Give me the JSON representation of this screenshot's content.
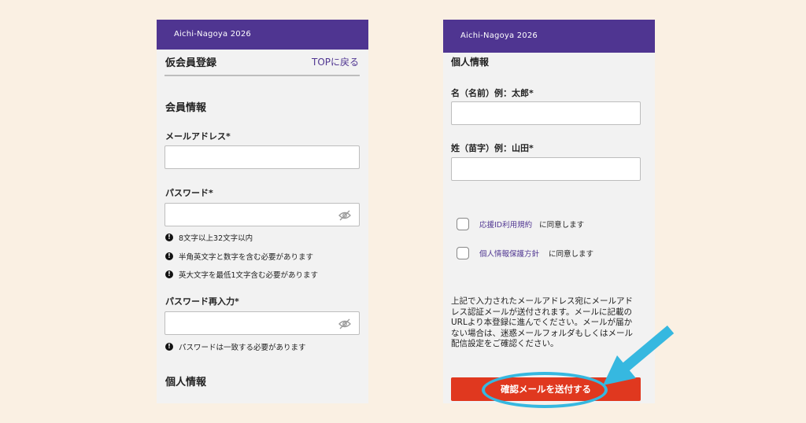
{
  "left": {
    "header": "Aichi-Nagoya 2026",
    "page_title": "仮会員登録",
    "top_link": "TOPに戻る",
    "section_member": "会員情報",
    "email_label": "メールアドレス*",
    "password_label": "パスワード*",
    "password_rules": [
      "8文字以上32文字以内",
      "半角英文字と数字を含む必要があります",
      "英大文字を最低1文字含む必要があります"
    ],
    "password_confirm_label": "パスワード再入力*",
    "password_confirm_rule": "パスワードは一致する必要があります",
    "section_personal": "個人情報"
  },
  "right": {
    "header": "Aichi-Nagoya 2026",
    "section_personal": "個人情報",
    "first_name_label": "名（名前）例：太郎*",
    "last_name_label": "姓（苗字）例：山田*",
    "agreements": [
      {
        "link": "応援ID利用規約",
        "text": "に同意します"
      },
      {
        "link": "個人情報保護方針",
        "text": "に同意します"
      }
    ],
    "notice": "上記で入力されたメールアドレス宛にメールアドレス認証メールが送付されます。メールに記載のURLより本登録に進んでください。メールが届かない場合は、迷惑メールフォルダもしくはメール配信設定をご確認ください。",
    "submit_label": "確認メールを送付する"
  },
  "colors": {
    "header_bg": "#4f3591",
    "submit_bg": "#e0381f",
    "highlight": "#36b8e0",
    "background": "#faf0e3"
  }
}
